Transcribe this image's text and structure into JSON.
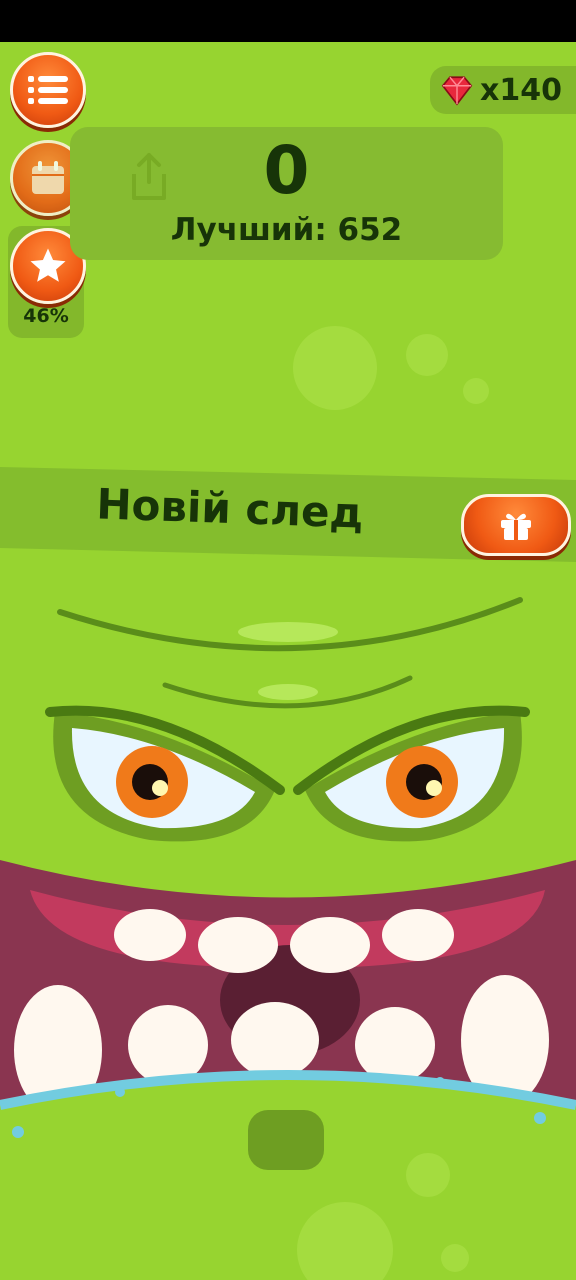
{
  "hud": {
    "stars_percent": "46%",
    "gems_count": "x140"
  },
  "score": {
    "value": "0",
    "best_label": "Лучший: 652"
  },
  "banner": {
    "text": "Новій след"
  },
  "icons": {
    "menu": "list-icon",
    "calendar": "calendar-icon",
    "star": "star-icon",
    "gem": "gem-icon",
    "share": "share-icon",
    "gift": "gift-icon"
  },
  "colors": {
    "background": "#97d430",
    "accent": "#f05a14",
    "text": "#173408",
    "mouth": "#8a3550"
  }
}
